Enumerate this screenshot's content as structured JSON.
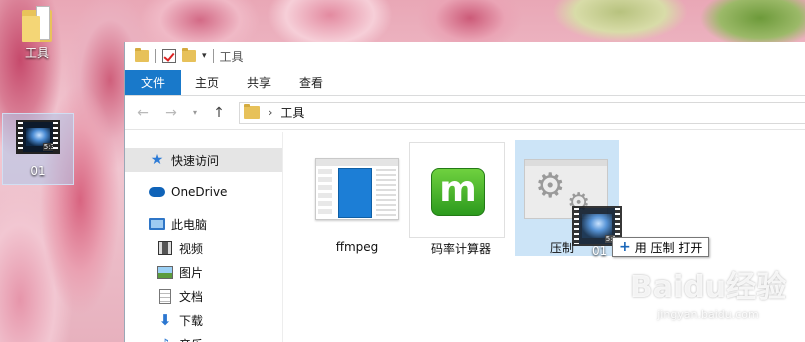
{
  "desktop": {
    "folder_label": "工具",
    "video_label": "01",
    "video_badge": "5:3"
  },
  "window": {
    "title": "工具",
    "ribbon_tabs": [
      "文件",
      "主页",
      "共享",
      "查看"
    ],
    "address": "工具",
    "nav_items": [
      {
        "label": "快速访问",
        "icon": "star-icon"
      },
      {
        "label": "OneDrive",
        "icon": "cloud-icon"
      },
      {
        "label": "此电脑",
        "icon": "computer-icon"
      },
      {
        "label": "视频",
        "icon": "video-folder-icon"
      },
      {
        "label": "图片",
        "icon": "picture-folder-icon"
      },
      {
        "label": "文档",
        "icon": "document-folder-icon"
      },
      {
        "label": "下载",
        "icon": "download-folder-icon"
      },
      {
        "label": "音乐",
        "icon": "music-folder-icon"
      }
    ],
    "files": [
      {
        "label": "ffmpeg",
        "icon": "app-window-thumbnail"
      },
      {
        "label": "码率计算器",
        "icon": "m-logo-icon"
      },
      {
        "label": "压制",
        "icon": "gear-app-icon"
      }
    ]
  },
  "drag": {
    "file_label": "01",
    "tooltip_verb": "用 压制 打开",
    "tooltip_symbol": "+"
  },
  "watermark": {
    "main": "Baidu经验",
    "sub": "jingyan.baidu.com"
  }
}
